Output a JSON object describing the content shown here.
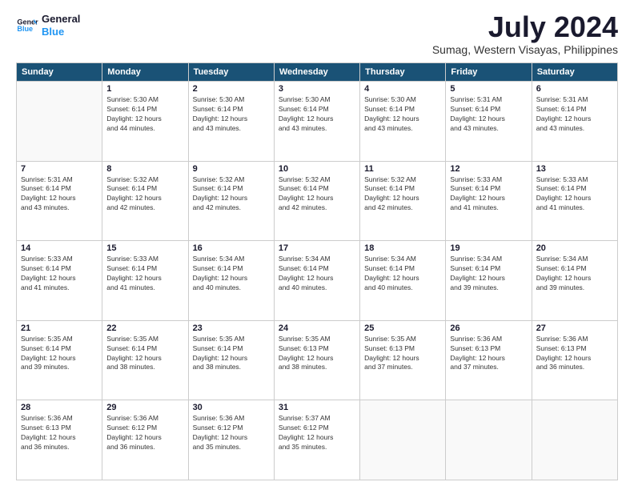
{
  "logo": {
    "line1": "General",
    "line2": "Blue"
  },
  "title": "July 2024",
  "location": "Sumag, Western Visayas, Philippines",
  "weekdays": [
    "Sunday",
    "Monday",
    "Tuesday",
    "Wednesday",
    "Thursday",
    "Friday",
    "Saturday"
  ],
  "weeks": [
    [
      {
        "day": "",
        "info": ""
      },
      {
        "day": "1",
        "info": "Sunrise: 5:30 AM\nSunset: 6:14 PM\nDaylight: 12 hours\nand 44 minutes."
      },
      {
        "day": "2",
        "info": "Sunrise: 5:30 AM\nSunset: 6:14 PM\nDaylight: 12 hours\nand 43 minutes."
      },
      {
        "day": "3",
        "info": "Sunrise: 5:30 AM\nSunset: 6:14 PM\nDaylight: 12 hours\nand 43 minutes."
      },
      {
        "day": "4",
        "info": "Sunrise: 5:30 AM\nSunset: 6:14 PM\nDaylight: 12 hours\nand 43 minutes."
      },
      {
        "day": "5",
        "info": "Sunrise: 5:31 AM\nSunset: 6:14 PM\nDaylight: 12 hours\nand 43 minutes."
      },
      {
        "day": "6",
        "info": "Sunrise: 5:31 AM\nSunset: 6:14 PM\nDaylight: 12 hours\nand 43 minutes."
      }
    ],
    [
      {
        "day": "7",
        "info": "Sunrise: 5:31 AM\nSunset: 6:14 PM\nDaylight: 12 hours\nand 43 minutes."
      },
      {
        "day": "8",
        "info": "Sunrise: 5:32 AM\nSunset: 6:14 PM\nDaylight: 12 hours\nand 42 minutes."
      },
      {
        "day": "9",
        "info": "Sunrise: 5:32 AM\nSunset: 6:14 PM\nDaylight: 12 hours\nand 42 minutes."
      },
      {
        "day": "10",
        "info": "Sunrise: 5:32 AM\nSunset: 6:14 PM\nDaylight: 12 hours\nand 42 minutes."
      },
      {
        "day": "11",
        "info": "Sunrise: 5:32 AM\nSunset: 6:14 PM\nDaylight: 12 hours\nand 42 minutes."
      },
      {
        "day": "12",
        "info": "Sunrise: 5:33 AM\nSunset: 6:14 PM\nDaylight: 12 hours\nand 41 minutes."
      },
      {
        "day": "13",
        "info": "Sunrise: 5:33 AM\nSunset: 6:14 PM\nDaylight: 12 hours\nand 41 minutes."
      }
    ],
    [
      {
        "day": "14",
        "info": "Sunrise: 5:33 AM\nSunset: 6:14 PM\nDaylight: 12 hours\nand 41 minutes."
      },
      {
        "day": "15",
        "info": "Sunrise: 5:33 AM\nSunset: 6:14 PM\nDaylight: 12 hours\nand 41 minutes."
      },
      {
        "day": "16",
        "info": "Sunrise: 5:34 AM\nSunset: 6:14 PM\nDaylight: 12 hours\nand 40 minutes."
      },
      {
        "day": "17",
        "info": "Sunrise: 5:34 AM\nSunset: 6:14 PM\nDaylight: 12 hours\nand 40 minutes."
      },
      {
        "day": "18",
        "info": "Sunrise: 5:34 AM\nSunset: 6:14 PM\nDaylight: 12 hours\nand 40 minutes."
      },
      {
        "day": "19",
        "info": "Sunrise: 5:34 AM\nSunset: 6:14 PM\nDaylight: 12 hours\nand 39 minutes."
      },
      {
        "day": "20",
        "info": "Sunrise: 5:34 AM\nSunset: 6:14 PM\nDaylight: 12 hours\nand 39 minutes."
      }
    ],
    [
      {
        "day": "21",
        "info": "Sunrise: 5:35 AM\nSunset: 6:14 PM\nDaylight: 12 hours\nand 39 minutes."
      },
      {
        "day": "22",
        "info": "Sunrise: 5:35 AM\nSunset: 6:14 PM\nDaylight: 12 hours\nand 38 minutes."
      },
      {
        "day": "23",
        "info": "Sunrise: 5:35 AM\nSunset: 6:14 PM\nDaylight: 12 hours\nand 38 minutes."
      },
      {
        "day": "24",
        "info": "Sunrise: 5:35 AM\nSunset: 6:13 PM\nDaylight: 12 hours\nand 38 minutes."
      },
      {
        "day": "25",
        "info": "Sunrise: 5:35 AM\nSunset: 6:13 PM\nDaylight: 12 hours\nand 37 minutes."
      },
      {
        "day": "26",
        "info": "Sunrise: 5:36 AM\nSunset: 6:13 PM\nDaylight: 12 hours\nand 37 minutes."
      },
      {
        "day": "27",
        "info": "Sunrise: 5:36 AM\nSunset: 6:13 PM\nDaylight: 12 hours\nand 36 minutes."
      }
    ],
    [
      {
        "day": "28",
        "info": "Sunrise: 5:36 AM\nSunset: 6:13 PM\nDaylight: 12 hours\nand 36 minutes."
      },
      {
        "day": "29",
        "info": "Sunrise: 5:36 AM\nSunset: 6:12 PM\nDaylight: 12 hours\nand 36 minutes."
      },
      {
        "day": "30",
        "info": "Sunrise: 5:36 AM\nSunset: 6:12 PM\nDaylight: 12 hours\nand 35 minutes."
      },
      {
        "day": "31",
        "info": "Sunrise: 5:37 AM\nSunset: 6:12 PM\nDaylight: 12 hours\nand 35 minutes."
      },
      {
        "day": "",
        "info": ""
      },
      {
        "day": "",
        "info": ""
      },
      {
        "day": "",
        "info": ""
      }
    ]
  ]
}
